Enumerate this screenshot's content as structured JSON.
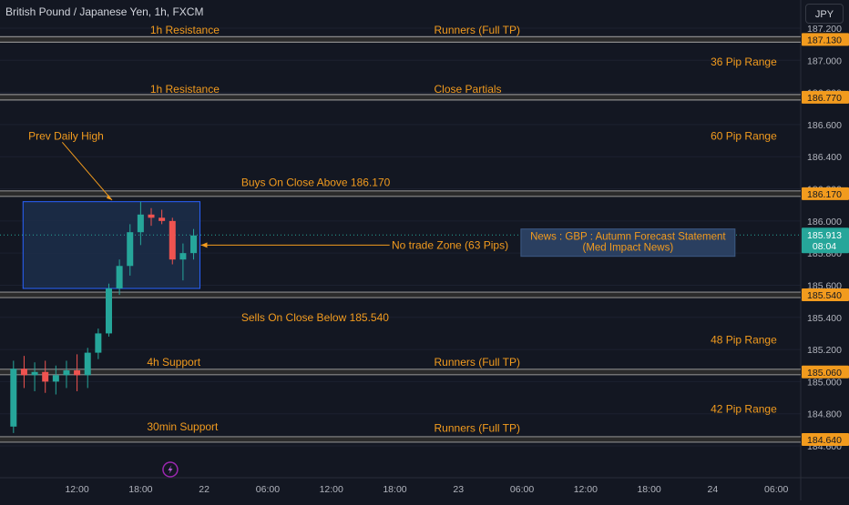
{
  "header": {
    "symbol_title": "British Pound / Japanese Yen, 1h, FXCM",
    "currency_label": "JPY"
  },
  "colors": {
    "background": "#131722",
    "annotation": "#f29b1e",
    "level_line": "#8a8a8a",
    "bull": "#26a69a",
    "bear": "#ef5350",
    "zone_fill": "#1c2e4a",
    "zone_border": "#2962ff",
    "news_fill": "#2a3f60",
    "axis_text": "#b2b5be",
    "price_tag": "#f29b1e",
    "current_tag": "#26a69a"
  },
  "chart_data": {
    "type": "candlestick",
    "title": "British Pound / Japanese Yen, 1h, FXCM",
    "ylabel": "JPY",
    "ylim": [
      184.5,
      187.35
    ],
    "y_ticks": [
      "187.200",
      "187.000",
      "186.800",
      "186.600",
      "186.400",
      "186.200",
      "186.000",
      "185.800",
      "185.600",
      "185.400",
      "185.200",
      "185.000",
      "184.800",
      "184.600"
    ],
    "x_ticks": [
      {
        "label": "12:00",
        "slot": 6.5
      },
      {
        "label": "18:00",
        "slot": 12.5
      },
      {
        "label": "22",
        "slot": 18.5
      },
      {
        "label": "06:00",
        "slot": 24.5
      },
      {
        "label": "12:00",
        "slot": 30.5
      },
      {
        "label": "18:00",
        "slot": 36.5
      },
      {
        "label": "23",
        "slot": 42.5
      },
      {
        "label": "06:00",
        "slot": 48.5
      },
      {
        "label": "12:00",
        "slot": 54.5
      },
      {
        "label": "18:00",
        "slot": 60.5
      },
      {
        "label": "24",
        "slot": 66.5
      },
      {
        "label": "06:00",
        "slot": 72.5
      }
    ],
    "candles": [
      {
        "o": 184.72,
        "h": 185.13,
        "l": 184.68,
        "c": 185.08
      },
      {
        "o": 185.08,
        "h": 185.16,
        "l": 184.96,
        "c": 185.04
      },
      {
        "o": 185.04,
        "h": 185.12,
        "l": 184.94,
        "c": 185.06
      },
      {
        "o": 185.06,
        "h": 185.13,
        "l": 184.93,
        "c": 185.0
      },
      {
        "o": 185.0,
        "h": 185.1,
        "l": 184.92,
        "c": 185.04
      },
      {
        "o": 185.04,
        "h": 185.13,
        "l": 184.96,
        "c": 185.07
      },
      {
        "o": 185.07,
        "h": 185.17,
        "l": 184.94,
        "c": 185.04
      },
      {
        "o": 185.04,
        "h": 185.21,
        "l": 184.96,
        "c": 185.18
      },
      {
        "o": 185.18,
        "h": 185.33,
        "l": 185.14,
        "c": 185.3
      },
      {
        "o": 185.3,
        "h": 185.61,
        "l": 185.28,
        "c": 185.58
      },
      {
        "o": 185.58,
        "h": 185.76,
        "l": 185.54,
        "c": 185.72
      },
      {
        "o": 185.72,
        "h": 185.98,
        "l": 185.66,
        "c": 185.93
      },
      {
        "o": 185.93,
        "h": 186.12,
        "l": 185.85,
        "c": 186.04
      },
      {
        "o": 186.04,
        "h": 186.08,
        "l": 185.97,
        "c": 186.02
      },
      {
        "o": 186.02,
        "h": 186.07,
        "l": 185.98,
        "c": 186.0
      },
      {
        "o": 186.0,
        "h": 186.02,
        "l": 185.73,
        "c": 185.76
      },
      {
        "o": 185.76,
        "h": 185.86,
        "l": 185.63,
        "c": 185.8
      },
      {
        "o": 185.8,
        "h": 185.95,
        "l": 185.76,
        "c": 185.91
      }
    ],
    "levels": [
      {
        "price": 187.13,
        "tag": "187.130"
      },
      {
        "price": 186.77,
        "tag": "186.770"
      },
      {
        "price": 186.17,
        "tag": "186.170"
      },
      {
        "price": 185.54,
        "tag": "185.540"
      },
      {
        "price": 185.06,
        "tag": "185.060"
      },
      {
        "price": 184.64,
        "tag": "184.640"
      }
    ],
    "current_price": {
      "price": 185.913,
      "label": "185.913",
      "countdown": "08:04"
    },
    "no_trade_zone": {
      "price_top": 186.12,
      "price_bottom": 185.58,
      "slot_start": 1.4,
      "slot_end": 18.1
    },
    "news_box": {
      "line1": "News : GBP : Autumn Forecast Statement",
      "line2": "(Med Impact News)"
    },
    "annotations": [
      {
        "text": "1h Resistance",
        "price": 187.19,
        "slot": 13.4,
        "anchor": "start"
      },
      {
        "text": "Runners (Full TP)",
        "price": 187.19,
        "slot": 40.2,
        "anchor": "start"
      },
      {
        "text": "36 Pip Range",
        "price": 186.99,
        "slot": 66.3,
        "anchor": "start"
      },
      {
        "text": "1h Resistance",
        "price": 186.82,
        "slot": 13.4,
        "anchor": "start"
      },
      {
        "text": "Close Partials",
        "price": 186.82,
        "slot": 40.2,
        "anchor": "start"
      },
      {
        "text": "Prev Daily High",
        "price": 186.53,
        "slot": 1.9,
        "anchor": "start"
      },
      {
        "text": "60 Pip Range",
        "price": 186.53,
        "slot": 66.3,
        "anchor": "start"
      },
      {
        "text": "Buys On Close Above 186.170",
        "price": 186.24,
        "slot": 22.0,
        "anchor": "start"
      },
      {
        "text": "No trade Zone (63 Pips)",
        "price": 185.85,
        "slot": 36.2,
        "anchor": "start"
      },
      {
        "text": "Sells On Close Below 185.540",
        "price": 185.4,
        "slot": 22.0,
        "anchor": "start"
      },
      {
        "text": "48 Pip Range",
        "price": 185.26,
        "slot": 66.3,
        "anchor": "start"
      },
      {
        "text": "4h Support",
        "price": 185.12,
        "slot": 13.1,
        "anchor": "start"
      },
      {
        "text": "Runners (Full TP)",
        "price": 185.12,
        "slot": 40.2,
        "anchor": "start"
      },
      {
        "text": "42 Pip Range",
        "price": 184.83,
        "slot": 66.3,
        "anchor": "start"
      },
      {
        "text": "30min Support",
        "price": 184.72,
        "slot": 13.1,
        "anchor": "start"
      },
      {
        "text": "Runners (Full TP)",
        "price": 184.71,
        "slot": 40.2,
        "anchor": "start"
      }
    ]
  }
}
